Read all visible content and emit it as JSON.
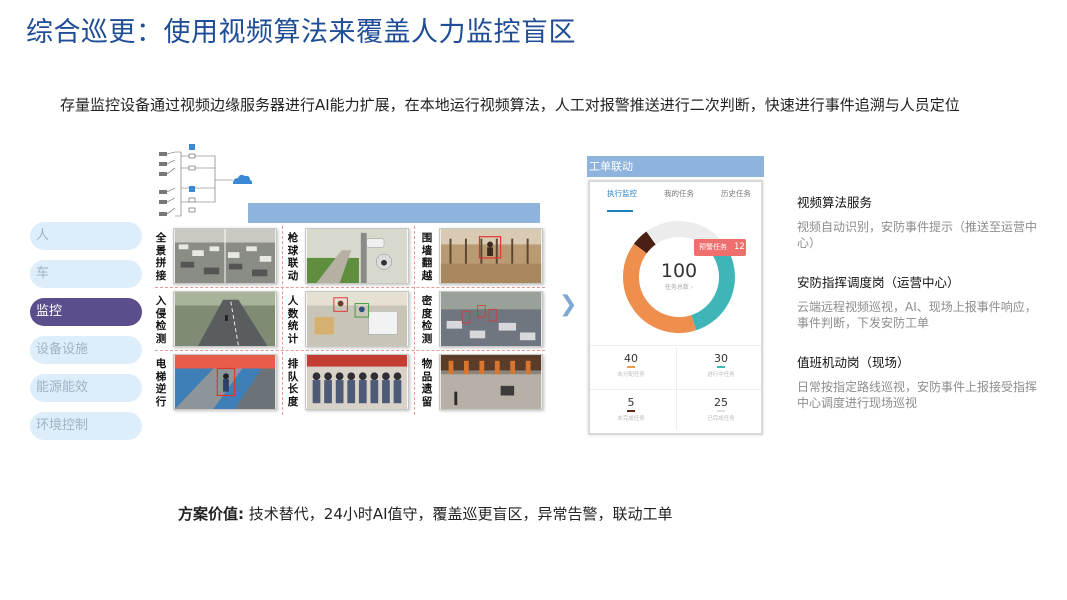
{
  "slide": {
    "title": "综合巡更：使用视频算法来覆盖人力监控盲区",
    "subtitle": "存量监控设备通过视频边缘服务器进行AI能力扩展，在本地运行视频算法，人工对报警推送进行二次判断，快速进行事件追溯与人员定位"
  },
  "menu": {
    "items": [
      {
        "label": "人",
        "active": false
      },
      {
        "label": "车",
        "active": false
      },
      {
        "label": "监控",
        "active": true
      },
      {
        "label": "设备设施",
        "active": false
      },
      {
        "label": "能源能效",
        "active": false
      },
      {
        "label": "环境控制",
        "active": false
      }
    ]
  },
  "scenarios": [
    [
      "全景拼接",
      "枪球联动",
      "围墙翻越"
    ],
    [
      "入侵检测",
      "人数统计",
      "密度检测"
    ],
    [
      "电梯逆行",
      "排队长度",
      "物品遗留"
    ]
  ],
  "phone": {
    "header": "工单联动",
    "tabs": [
      "执行监控",
      "我的任务",
      "历史任务"
    ],
    "total": "100",
    "total_label": "任务总数 ›",
    "badge_label": "预警任务",
    "badge_value": "12",
    "stats": [
      {
        "value": "40",
        "label": "未分配任务",
        "color": "#f29a4a"
      },
      {
        "value": "30",
        "label": "进行中任务",
        "color": "#3fb5b8"
      },
      {
        "value": "5",
        "label": "未完成任务",
        "color": "#5a2a1a"
      },
      {
        "value": "25",
        "label": "已完成任务",
        "color": "#e0e0e0"
      }
    ],
    "donut": [
      {
        "label": "进行中",
        "fraction": 0.3,
        "color": "#3fb5b8"
      },
      {
        "label": "未分配",
        "fraction": 0.4,
        "color": "#ee8f4d"
      },
      {
        "label": "未完成",
        "fraction": 0.05,
        "color": "#4a1f14"
      },
      {
        "label": "已完成",
        "fraction": 0.25,
        "color": "#ececec"
      }
    ],
    "colors": {
      "active_tab": "#1f7fbf",
      "badge": "#ef6e6e"
    }
  },
  "features": [
    {
      "title": "视频算法服务",
      "desc": "视频自动识别，安防事件提示（推送至运营中心）"
    },
    {
      "title": "安防指挥调度岗（运营中心）",
      "desc": "云端远程视频巡视，AI、现场上报事件响应，事件判断，下发安防工单"
    },
    {
      "title": "值班机动岗（现场）",
      "desc": "日常按指定路线巡视，安防事件上报接受指挥中心调度进行现场巡视"
    }
  ],
  "value": {
    "label": "方案价值:",
    "text": "技术替代，24小时AI值守，覆盖巡更盲区，异常告警，联动工单"
  },
  "theme": {
    "title_color": "#1f4e96",
    "menu_active": "#5c4d8c",
    "menu_bg": "#ddeefa",
    "bar_blue": "#8eb4de"
  }
}
